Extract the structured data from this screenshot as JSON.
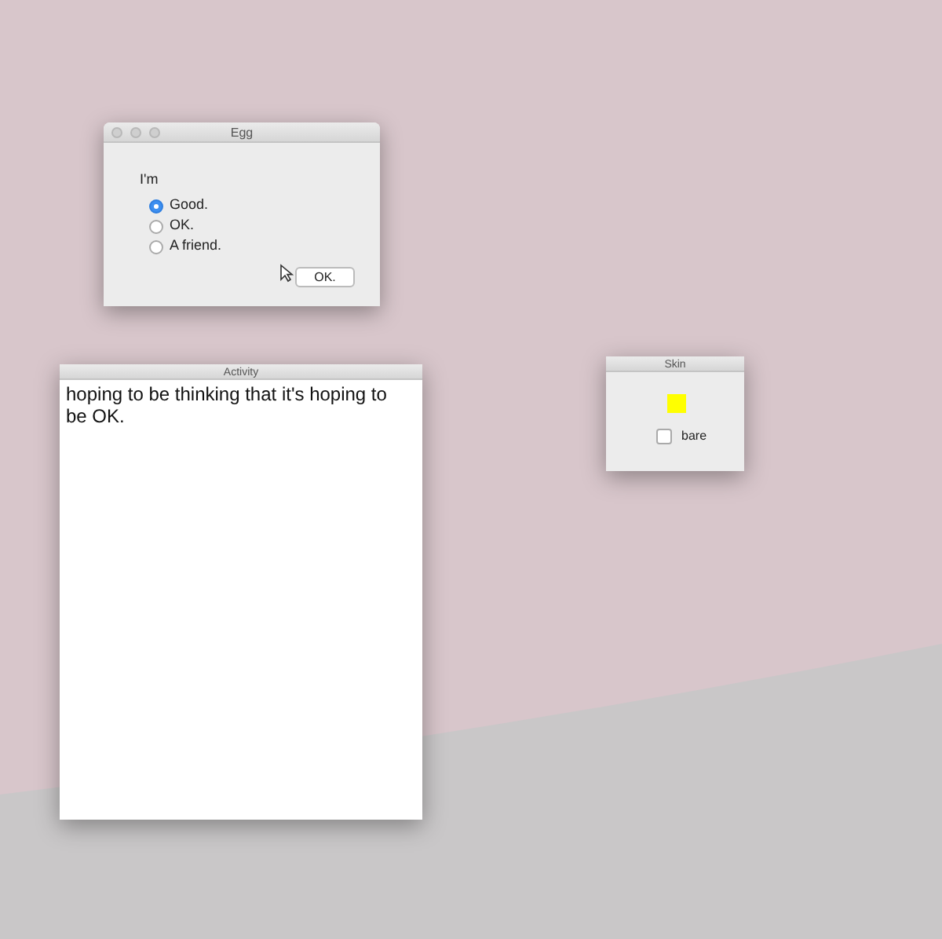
{
  "egg_window": {
    "title": "Egg",
    "prompt": "I'm",
    "options": [
      {
        "label": "Good.",
        "selected": true
      },
      {
        "label": "OK.",
        "selected": false
      },
      {
        "label": "A friend.",
        "selected": false
      }
    ],
    "button": "OK."
  },
  "activity_window": {
    "title": "Activity",
    "text": "hoping to be thinking that it's hoping to be OK."
  },
  "skin_window": {
    "title": "Skin",
    "checkbox": {
      "label": "bare",
      "checked": false
    }
  }
}
